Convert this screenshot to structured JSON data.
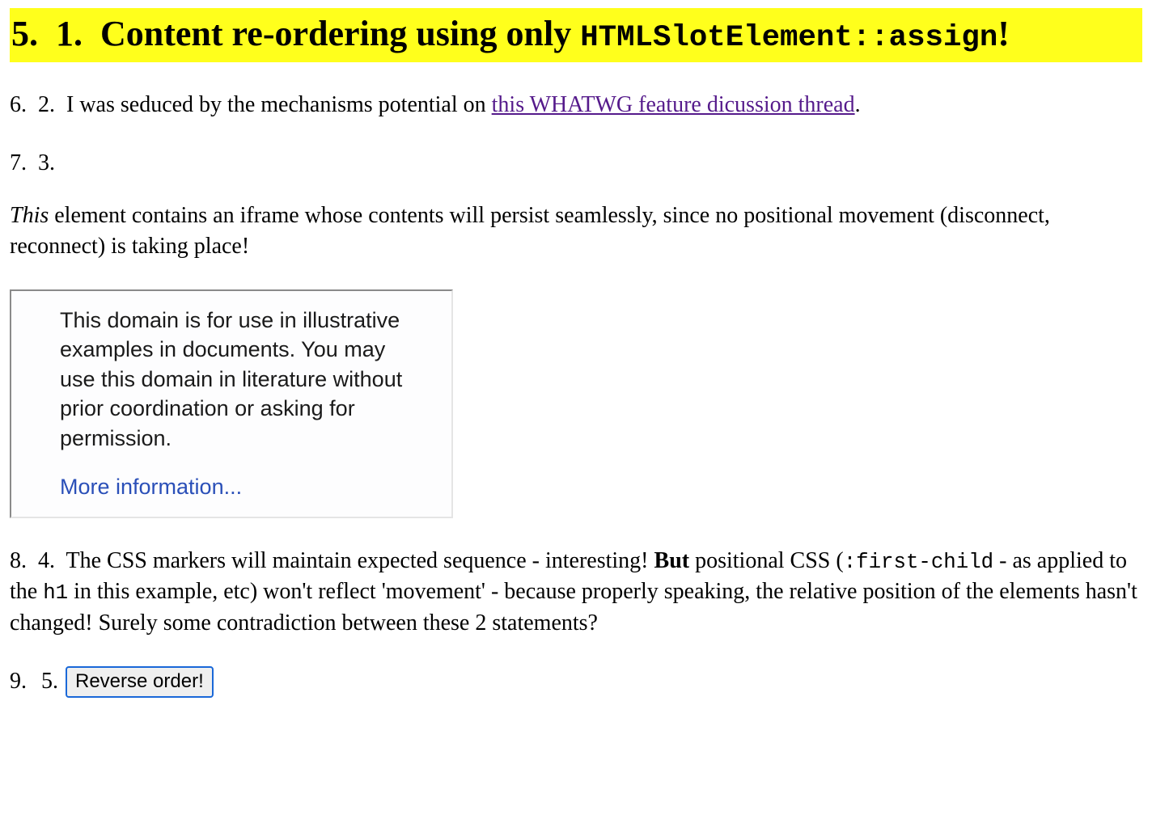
{
  "heading": {
    "outer_num": "5.",
    "inner_num": "1.",
    "title_prefix": "Content re-ordering using only",
    "code_part": "HTMLSlotElement::assign",
    "title_suffix": "!"
  },
  "item2": {
    "outer_num": "6.",
    "inner_num": "2.",
    "text_before_link": "I was seduced by the mechanisms potential on ",
    "link_text": "this WHATWG feature dicussion thread",
    "text_after_link": "."
  },
  "item3": {
    "outer_num": "7.",
    "inner_num": "3."
  },
  "item3_paragraph": {
    "emph": "This",
    "rest": " element contains an iframe whose contents will persist seamlessly, since no positional movement (disconnect, reconnect) is taking place!"
  },
  "iframe": {
    "body_text": "This domain is for use in illustrative examples in documents. You may use this domain in literature without prior coordination or asking for permission.",
    "link_text": "More information..."
  },
  "item4": {
    "outer_num": "8.",
    "inner_num": "4.",
    "text_a": "The CSS markers will maintain expected sequence - interesting! ",
    "bold": "But",
    "text_b": " positional CSS (",
    "code1": ":first-child",
    "text_c": " - as applied to the ",
    "code2": "h1",
    "text_d": " in this example, etc) won't reflect 'movement' - because properly speaking, the relative position of the elements hasn't changed! Surely some contradiction between these 2 statements?"
  },
  "item5": {
    "outer_num": "9.",
    "inner_num": "5.",
    "button_label": "Reverse order!"
  }
}
